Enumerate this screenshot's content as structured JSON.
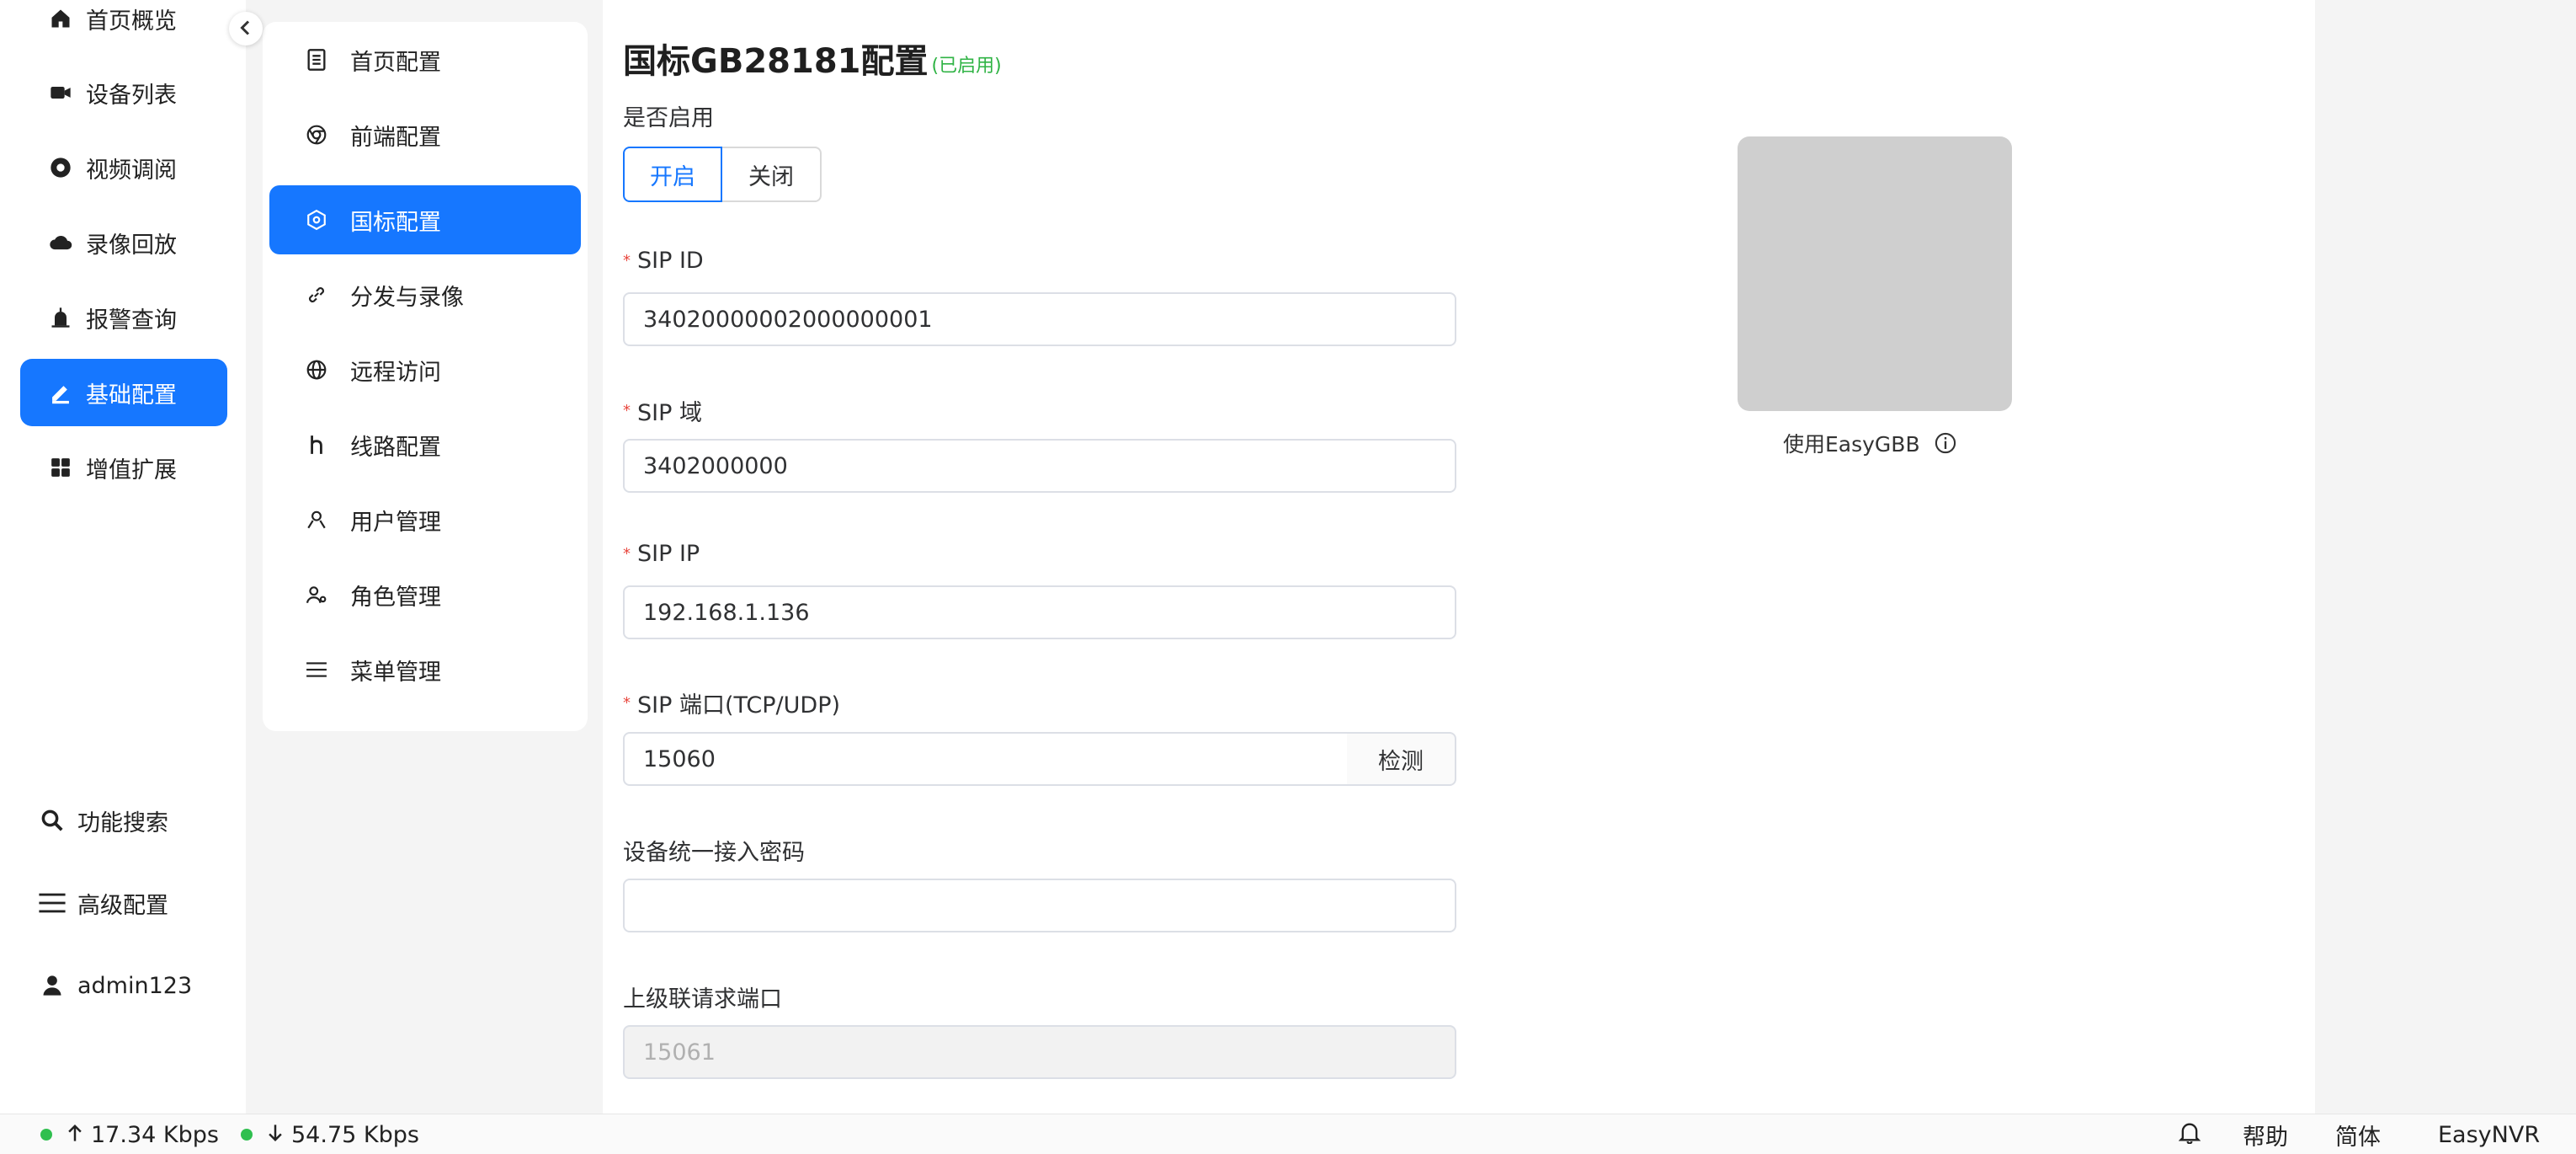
{
  "sidebar": {
    "items": [
      {
        "label": "首页概览",
        "icon": "home-icon"
      },
      {
        "label": "设备列表",
        "icon": "camera-icon"
      },
      {
        "label": "视频调阅",
        "icon": "video-icon"
      },
      {
        "label": "录像回放",
        "icon": "cloud-icon"
      },
      {
        "label": "报警查询",
        "icon": "alarm-icon"
      },
      {
        "label": "基础配置",
        "icon": "edit-icon",
        "active": true
      },
      {
        "label": "增值扩展",
        "icon": "grid-icon"
      }
    ],
    "bottom": {
      "search": "功能搜索",
      "advanced": "高级配置",
      "user": "admin123"
    }
  },
  "submenu": {
    "items": [
      {
        "label": "首页配置",
        "icon": "document-icon"
      },
      {
        "label": "前端配置",
        "icon": "chrome-icon"
      },
      {
        "label": "国标配置",
        "icon": "network-icon",
        "active": true
      },
      {
        "label": "分发与录像",
        "icon": "link-icon"
      },
      {
        "label": "远程访问",
        "icon": "globe-icon"
      },
      {
        "label": "线路配置",
        "icon": "route-icon"
      },
      {
        "label": "用户管理",
        "icon": "user-icon"
      },
      {
        "label": "角色管理",
        "icon": "role-icon"
      },
      {
        "label": "菜单管理",
        "icon": "menu-icon"
      }
    ]
  },
  "form": {
    "title": "国标GB28181配置",
    "status": "(已启用)",
    "enable_label": "是否启用",
    "enable_on": "开启",
    "enable_off": "关闭",
    "sip_id_label": "SIP ID",
    "sip_id_value": "34020000002000000001",
    "sip_domain_label": "SIP 域",
    "sip_domain_value": "3402000000",
    "sip_ip_label": "SIP IP",
    "sip_ip_value": "192.168.1.136",
    "sip_port_label": "SIP 端口(TCP/UDP)",
    "sip_port_value": "15060",
    "check_button": "检测",
    "password_label": "设备统一接入密码",
    "password_value": "",
    "cascade_port_label": "上级联请求端口",
    "cascade_port_value": "15061"
  },
  "qr": {
    "caption": "使用EasyGBB"
  },
  "statusbar": {
    "upload": "17.34 Kbps",
    "download": "54.75 Kbps",
    "help": "帮助",
    "language": "简体",
    "brand": "EasyNVR"
  },
  "colors": {
    "accent": "#1677ff",
    "enabled_status": "#2fb344",
    "required": "#e8463d",
    "online_dot": "#2fbf4f"
  }
}
